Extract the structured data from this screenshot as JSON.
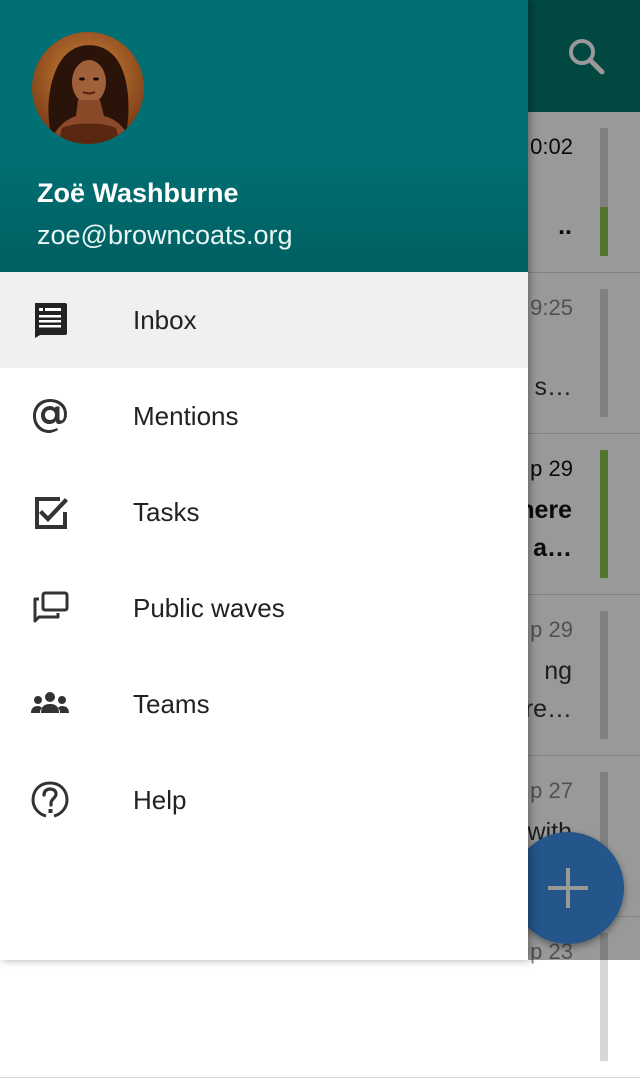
{
  "user": {
    "name": "Zoë Washburne",
    "email": "zoe@browncoats.org"
  },
  "menu": [
    {
      "label": "Inbox",
      "icon": "inbox-icon",
      "selected": true
    },
    {
      "label": "Mentions",
      "icon": "at-sign-icon",
      "selected": false
    },
    {
      "label": "Tasks",
      "icon": "checkbox-icon",
      "selected": false
    },
    {
      "label": "Public waves",
      "icon": "public-waves-icon",
      "selected": false
    },
    {
      "label": "Teams",
      "icon": "people-icon",
      "selected": false
    },
    {
      "label": "Help",
      "icon": "help-icon",
      "selected": false
    }
  ],
  "background_waves": [
    {
      "date": "0:02",
      "line1": "",
      "line2": "..",
      "unread": true,
      "unread_fraction": 0.38
    },
    {
      "date": "9:25",
      "line1": "",
      "line2": "s…",
      "unread": false,
      "unread_fraction": 0
    },
    {
      "date": "p 29",
      "line1": "here",
      "line2": "a…",
      "unread": true,
      "unread_fraction": 1.0
    },
    {
      "date": "p 29",
      "line1": "ng",
      "line2": "re…",
      "unread": false,
      "unread_fraction": 0
    },
    {
      "date": "p 27",
      "line1": "with",
      "line2": "",
      "unread": false,
      "unread_fraction": 0
    },
    {
      "date": "p 23",
      "line1": "",
      "line2": "",
      "unread": false,
      "unread_fraction": 0
    }
  ],
  "colors": {
    "primary": "#00796b",
    "accent": "#3d8ee8",
    "unread": "#8bc34a"
  }
}
